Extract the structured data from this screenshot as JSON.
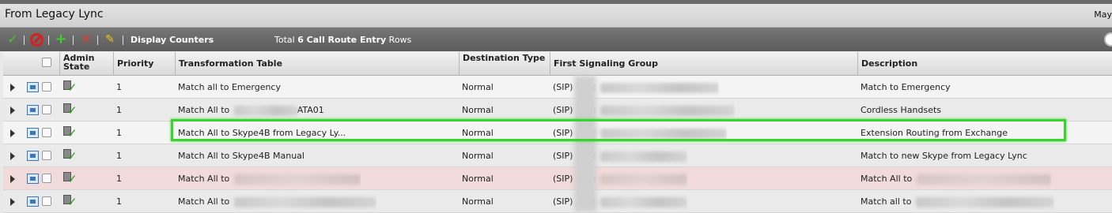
{
  "window": {
    "title": "From Legacy Lync",
    "right_text": "May"
  },
  "toolbar": {
    "display_counters": "Display Counters",
    "total_prefix": "Total",
    "total_count": "6 Call Route Entry",
    "total_suffix": "Rows"
  },
  "columns": {
    "admin_state": "Admin State",
    "priority": "Priority",
    "transformation_table": "Transformation Table",
    "destination_type": "Destination Type",
    "first_signaling_group": "First Signaling Group",
    "description": "Description"
  },
  "rows": [
    {
      "priority": "1",
      "transformation_table": "Match all to Emergency",
      "destination_type": "Normal",
      "signaling_prefix": "(SIP)",
      "signaling_sep": ":",
      "description": "Match to Emergency"
    },
    {
      "priority": "1",
      "transformation_table": "Match All to",
      "transformation_suffix": "ATA01",
      "destination_type": "Normal",
      "signaling_prefix": "(SIP)",
      "signaling_sep": ":",
      "description": "Cordless Handsets"
    },
    {
      "priority": "1",
      "transformation_table": "Match All to Skype4B from Legacy Ly...",
      "destination_type": "Normal",
      "signaling_prefix": "(SIP)",
      "signaling_sep": "",
      "description": "Extension Routing from Exchange"
    },
    {
      "priority": "1",
      "transformation_table": "Match All to Skype4B Manual",
      "destination_type": "Normal",
      "signaling_prefix": "(SIP)",
      "signaling_sep": ":",
      "description": "Match to new Skype from Legacy Lync"
    },
    {
      "priority": "1",
      "transformation_table": "Match All to",
      "destination_type": "Normal",
      "signaling_prefix": "(SIP)",
      "signaling_sep": ":",
      "description": "Match All to"
    },
    {
      "priority": "1",
      "transformation_table": "Match All to",
      "destination_type": "Normal",
      "signaling_prefix": "(SIP)",
      "signaling_sep": "",
      "description": "Match all to"
    }
  ],
  "colors": {
    "highlight": "#3bd42f",
    "selected_row": "#f0dada",
    "toolbar_bg": "#666666"
  }
}
